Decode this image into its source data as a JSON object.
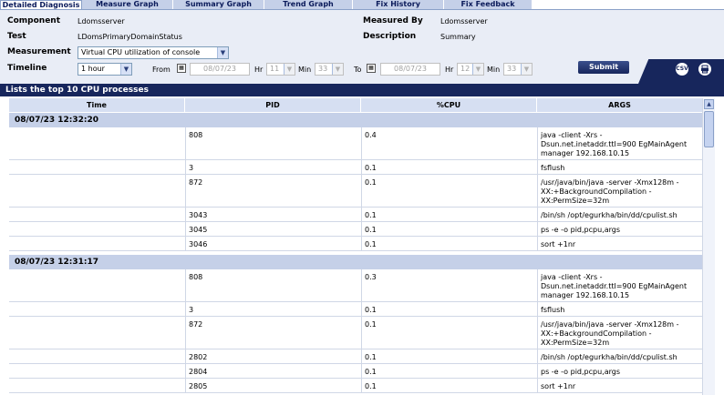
{
  "tabs": [
    "Detailed Diagnosis",
    "Measure Graph",
    "Summary Graph",
    "Trend Graph",
    "Fix History",
    "Fix Feedback"
  ],
  "header": {
    "component_label": "Component",
    "component_value": "Ldomsserver",
    "test_label": "Test",
    "test_value": "LDomsPrimaryDomainStatus",
    "measurement_label": "Measurement",
    "measurement_value": "Virtual CPU utilization of console",
    "measured_by_label": "Measured By",
    "measured_by_value": "Ldomsserver",
    "description_label": "Description",
    "description_value": "Summary",
    "timeline_label": "Timeline",
    "timeline_value": "1 hour",
    "from_label": "From",
    "from_date": "08/07/23",
    "from_hr_label": "Hr",
    "from_hr": "11",
    "from_min_label": "Min",
    "from_min": "33",
    "to_label": "To",
    "to_date": "08/07/23",
    "to_hr_label": "Hr",
    "to_hr": "12",
    "to_min_label": "Min",
    "to_min": "33",
    "submit_label": "Submit",
    "csv_label": "CSV"
  },
  "section_title": "Lists the top 10 CPU processes",
  "table": {
    "columns": [
      "Time",
      "PID",
      "%CPU",
      "ARGS"
    ],
    "groups": [
      {
        "time": "08/07/23 12:32:20",
        "rows": [
          {
            "pid": "808",
            "cpu": "0.4",
            "args": [
              "java -client -Xrs -",
              "Dsun.net.inetaddr.ttl=900 EgMainAgent",
              "manager 192.168.10.15"
            ]
          },
          {
            "pid": "3",
            "cpu": "0.1",
            "args": [
              "fsflush"
            ]
          },
          {
            "pid": "872",
            "cpu": "0.1",
            "args": [
              "/usr/java/bin/java -server -Xmx128m -",
              "XX:+BackgroundCompilation -",
              "XX:PermSize=32m"
            ]
          },
          {
            "pid": "3043",
            "cpu": "0.1",
            "args": [
              "/bin/sh /opt/egurkha/bin/dd/cpulist.sh"
            ]
          },
          {
            "pid": "3045",
            "cpu": "0.1",
            "args": [
              "ps -e -o pid,pcpu,args"
            ]
          },
          {
            "pid": "3046",
            "cpu": "0.1",
            "args": [
              "sort +1nr"
            ]
          }
        ]
      },
      {
        "time": "08/07/23 12:31:17",
        "rows": [
          {
            "pid": "808",
            "cpu": "0.3",
            "args": [
              "java -client -Xrs -",
              "Dsun.net.inetaddr.ttl=900 EgMainAgent",
              "manager 192.168.10.15"
            ]
          },
          {
            "pid": "3",
            "cpu": "0.1",
            "args": [
              "fsflush"
            ]
          },
          {
            "pid": "872",
            "cpu": "0.1",
            "args": [
              "/usr/java/bin/java -server -Xmx128m -",
              "XX:+BackgroundCompilation -",
              "XX:PermSize=32m"
            ]
          },
          {
            "pid": "2802",
            "cpu": "0.1",
            "args": [
              "/bin/sh /opt/egurkha/bin/dd/cpulist.sh"
            ]
          },
          {
            "pid": "2804",
            "cpu": "0.1",
            "args": [
              "ps -e -o pid,pcpu,args"
            ]
          },
          {
            "pid": "2805",
            "cpu": "0.1",
            "args": [
              "sort +1nr"
            ]
          }
        ]
      }
    ]
  },
  "colors": {
    "navy": "#17265c",
    "header_bg": "#e9edf6",
    "table_header": "#d6dff2",
    "group_bg": "#c5d0e8"
  }
}
